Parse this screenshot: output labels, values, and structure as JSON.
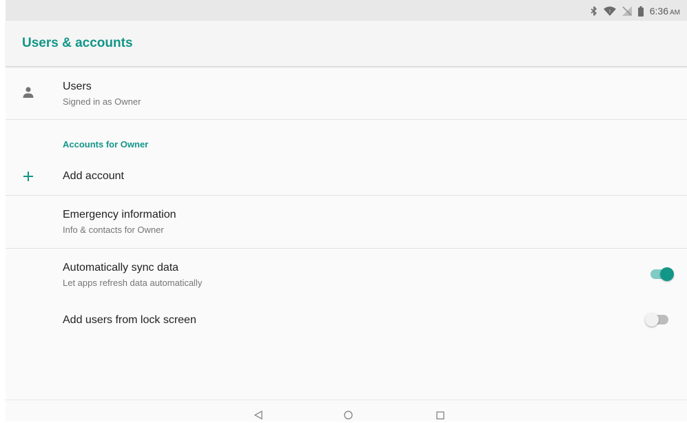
{
  "status_bar": {
    "time": "6:36",
    "ampm": "AM",
    "icons": [
      "bluetooth-icon",
      "wifi-icon",
      "no-sim-icon",
      "battery-icon"
    ]
  },
  "app_bar": {
    "title": "Users & accounts"
  },
  "users_item": {
    "title": "Users",
    "subtitle": "Signed in as Owner",
    "icon": "person-icon"
  },
  "accounts_section": {
    "header": "Accounts for Owner",
    "add_account": {
      "label": "Add account",
      "icon": "plus-icon"
    }
  },
  "emergency_item": {
    "title": "Emergency information",
    "subtitle": "Info & contacts for Owner"
  },
  "auto_sync": {
    "title": "Automatically sync data",
    "subtitle": "Let apps refresh data automatically",
    "enabled": true
  },
  "lock_screen_users": {
    "title": "Add users from lock screen",
    "enabled": false
  },
  "nav_bar": {
    "buttons": [
      "back-icon",
      "home-icon",
      "recents-icon"
    ]
  },
  "colors": {
    "accent": "#129688",
    "accent_track": "#80cbc4",
    "off_thumb": "#f1f1f1",
    "off_track": "#bdbdbd"
  }
}
